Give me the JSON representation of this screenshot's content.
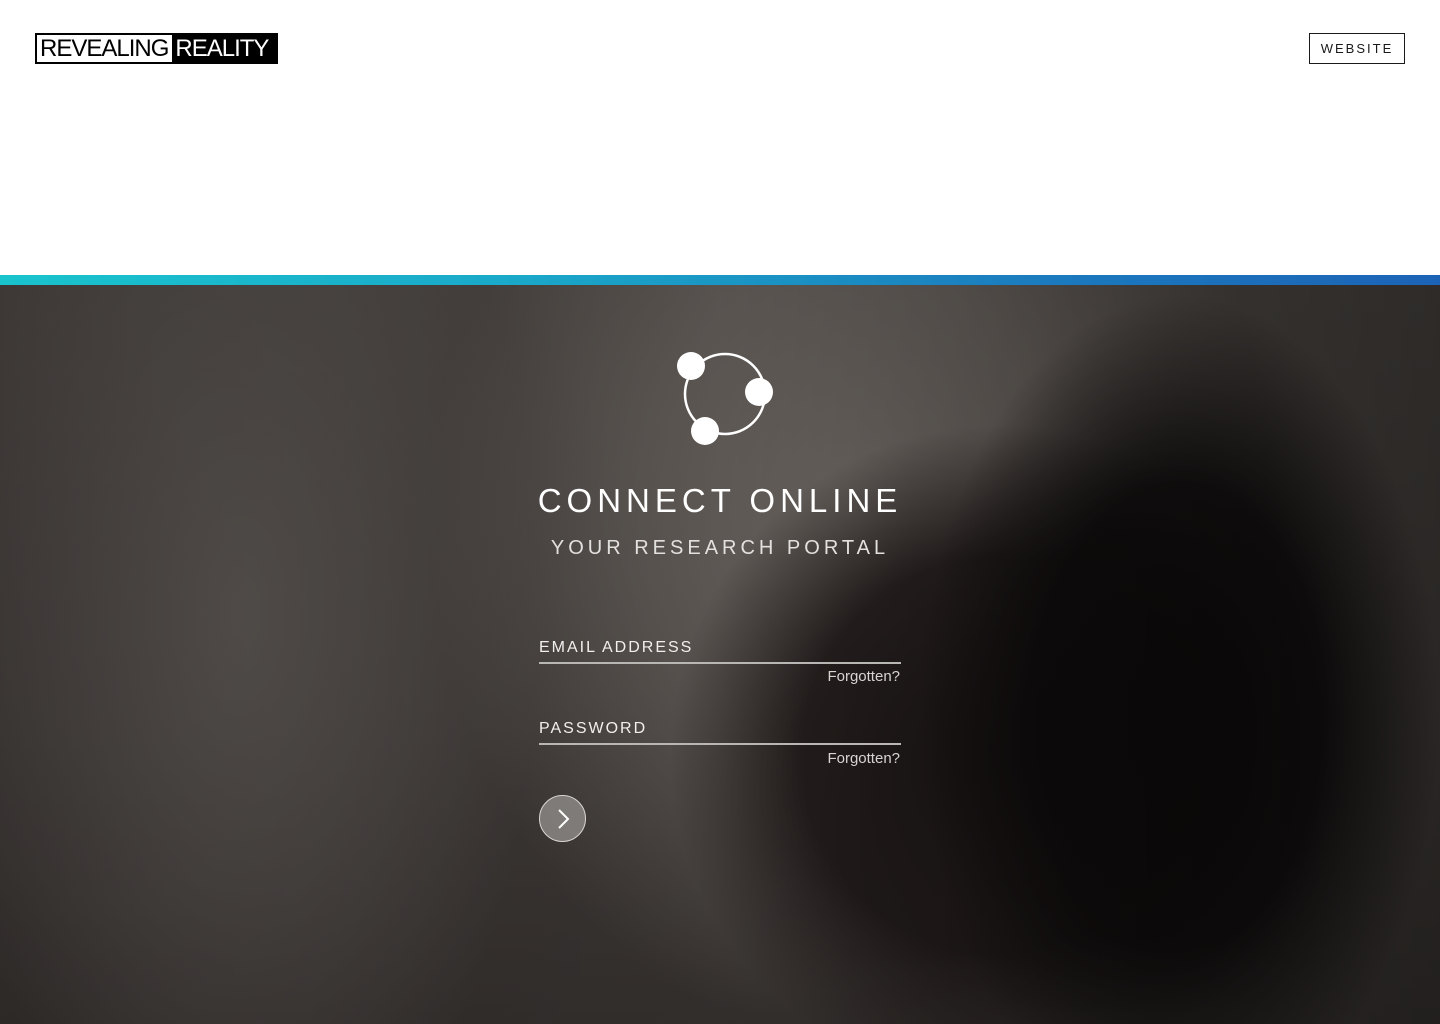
{
  "header": {
    "logo_word1": "REVEALING",
    "logo_word2": "REALITY",
    "website_label": "WEBSITE"
  },
  "accent": {
    "gradient_start": "#19c4cd",
    "gradient_end": "#1c63b6"
  },
  "hero": {
    "brand_icon": "three-node-ring-icon",
    "title": "CONNECT ONLINE",
    "subtitle": "YOUR RESEARCH PORTAL"
  },
  "login_form": {
    "email_placeholder": "EMAIL ADDRESS",
    "email_value": "",
    "email_forgot_label": "Forgotten?",
    "password_placeholder": "PASSWORD",
    "password_value": "",
    "password_forgot_label": "Forgotten?",
    "submit_icon": "chevron-right-icon"
  }
}
